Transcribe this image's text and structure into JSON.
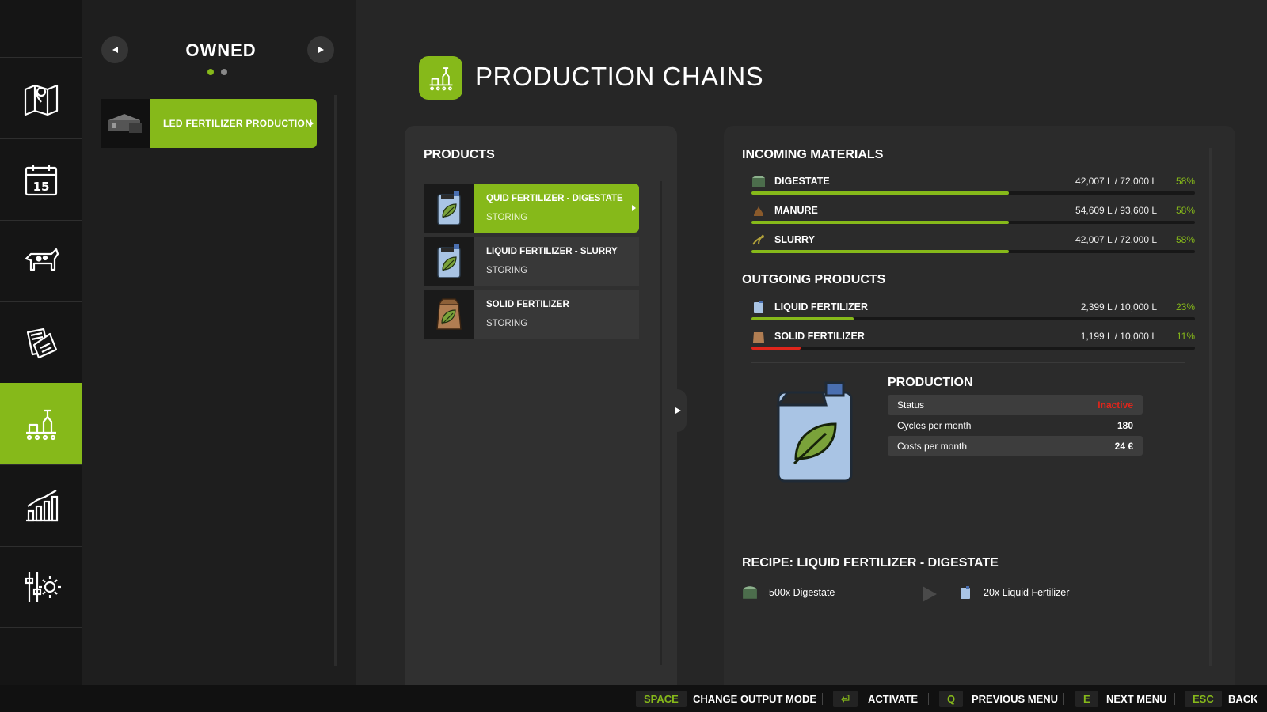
{
  "owned": {
    "title": "OWNED",
    "production_name": "LED FERTILIZER PRODUCTION"
  },
  "header": {
    "title": "PRODUCTION CHAINS"
  },
  "products": {
    "title": "PRODUCTS",
    "items": [
      {
        "name": "QUID FERTILIZER - DIGESTATE",
        "status": "STORING"
      },
      {
        "name": "LIQUID FERTILIZER - SLURRY",
        "status": "STORING"
      },
      {
        "name": "SOLID FERTILIZER",
        "status": "STORING"
      }
    ]
  },
  "incoming": {
    "title": "INCOMING MATERIALS",
    "items": [
      {
        "name": "DIGESTATE",
        "amount": "42,007 L / 72,000 L",
        "percent": "58%",
        "fill": 0.58
      },
      {
        "name": "MANURE",
        "amount": "54,609 L / 93,600 L",
        "percent": "58%",
        "fill": 0.58
      },
      {
        "name": "SLURRY",
        "amount": "42,007 L / 72,000 L",
        "percent": "58%",
        "fill": 0.58
      }
    ]
  },
  "outgoing": {
    "title": "OUTGOING PRODUCTS",
    "items": [
      {
        "name": "LIQUID FERTILIZER",
        "amount": "2,399 L / 10,000 L",
        "percent": "23%",
        "fill": 0.23
      },
      {
        "name": "SOLID FERTILIZER",
        "amount": "1,199 L / 10,000 L",
        "percent": "11%",
        "fill": 0.11
      }
    ]
  },
  "production": {
    "title": "PRODUCTION",
    "rows": [
      {
        "label": "Status",
        "value": "Inactive"
      },
      {
        "label": "Cycles per month",
        "value": "180"
      },
      {
        "label": "Costs per month",
        "value": "24 €"
      }
    ]
  },
  "recipe": {
    "title": "RECIPE: LIQUID FERTILIZER - DIGESTATE",
    "input": "500x Digestate",
    "output": "20x Liquid Fertilizer"
  },
  "bottom_bar": {
    "actions": [
      {
        "key": "SPACE",
        "label": "CHANGE OUTPUT MODE"
      },
      {
        "key": "⏎",
        "label": "ACTIVATE"
      },
      {
        "key": "Q",
        "label": "PREVIOUS MENU"
      },
      {
        "key": "E",
        "label": "NEXT MENU"
      },
      {
        "key": "ESC",
        "label": "BACK"
      }
    ]
  },
  "colors": {
    "accent": "#86b91a",
    "bar_low": "#e0251b",
    "status_inactive": "#e0251b",
    "background": "#262626"
  },
  "icons": {
    "sidebar": [
      "map-icon",
      "calendar-icon",
      "animals-icon",
      "contracts-icon",
      "production-icon",
      "statistics-icon",
      "settings-icon"
    ],
    "calendar_day": "15"
  }
}
